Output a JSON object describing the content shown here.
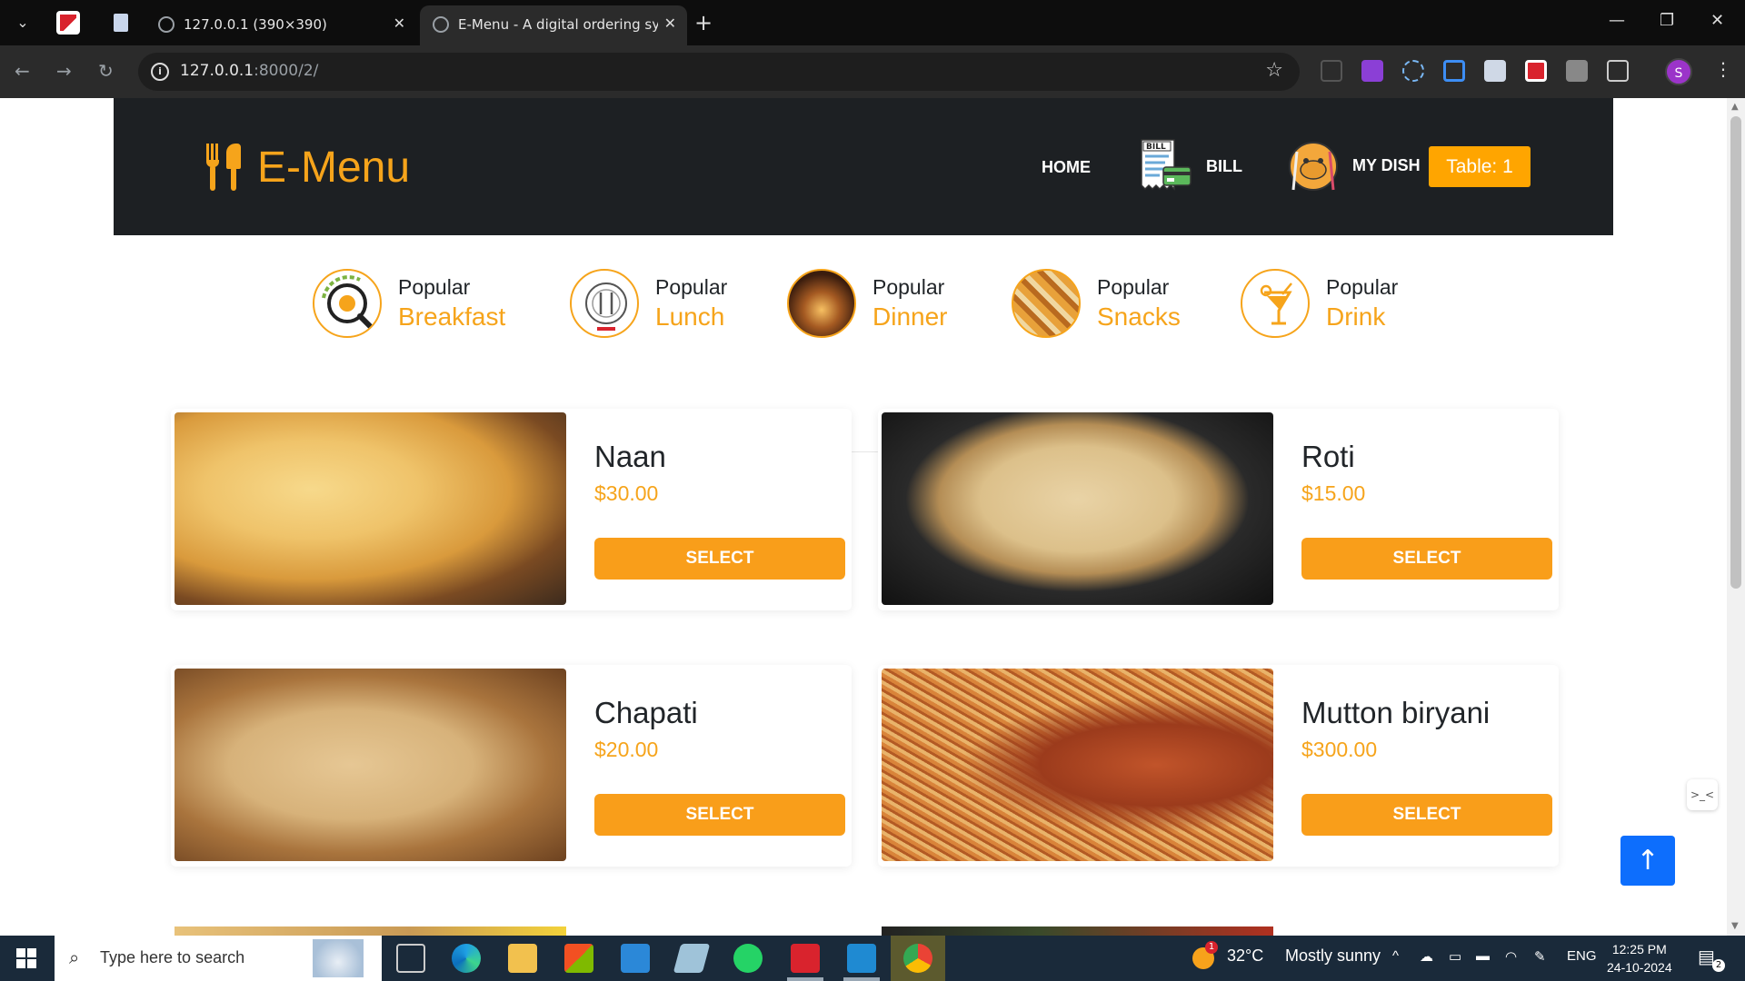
{
  "browser": {
    "tabs": [
      {
        "title": "127.0.0.1 (390×390)"
      },
      {
        "title": "E-Menu - A digital ordering sys"
      }
    ],
    "url_host": "127.0.0.1",
    "url_path": ":8000/2/",
    "profile_initial": "S"
  },
  "header": {
    "logo_text": "E-Menu",
    "nav": {
      "home": "HOME",
      "bill": "BILL",
      "my_dish": "MY DISH",
      "bill_icon_text": "BILL"
    },
    "table_badge": "Table: 1"
  },
  "categories": [
    {
      "small": "Popular",
      "big": "Breakfast",
      "icon": "breakfast-icon"
    },
    {
      "small": "Popular",
      "big": "Lunch",
      "icon": "lunch-plate-icon"
    },
    {
      "small": "Popular",
      "big": "Dinner",
      "icon": "dinner-icon"
    },
    {
      "small": "Popular",
      "big": "Snacks",
      "icon": "snacks-icon"
    },
    {
      "small": "Popular",
      "big": "Drink",
      "icon": "drink-icon"
    }
  ],
  "active_category": "Lunch",
  "dishes": [
    {
      "name": "Naan",
      "price": "$30.00",
      "button": "SELECT"
    },
    {
      "name": "Roti",
      "price": "$15.00",
      "button": "SELECT"
    },
    {
      "name": "Chapati",
      "price": "$20.00",
      "button": "SELECT"
    },
    {
      "name": "Mutton biryani",
      "price": "$300.00",
      "button": "SELECT"
    }
  ],
  "taskbar": {
    "search_placeholder": "Type here to search",
    "weather_temp": "32°C",
    "weather_text": "Mostly sunny",
    "weather_badge": "1",
    "lang": "ENG",
    "time": "12:25 PM",
    "date": "24-10-2024",
    "notification_count": "2"
  },
  "colors": {
    "accent": "#f6a41b",
    "header_bg": "#1d2023",
    "button": "#f99e1a",
    "scroll_top": "#0d6efd"
  }
}
